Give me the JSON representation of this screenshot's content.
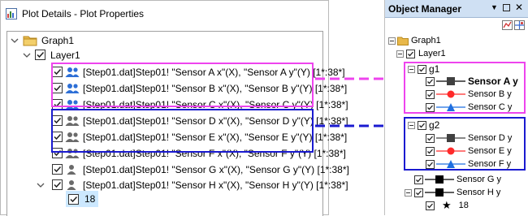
{
  "plot_details": {
    "title": "Plot Details - Plot Properties",
    "tree": {
      "graph": "Graph1",
      "layer": "Layer1",
      "plots": [
        {
          "label": "[Step01.dat]Step01! \"Sensor A x\"(X), \"Sensor A y\"(Y) [1*:38*]",
          "group": "g1"
        },
        {
          "label": "[Step01.dat]Step01! \"Sensor B x\"(X), \"Sensor B y\"(Y) [1*:38*]",
          "group": "g1"
        },
        {
          "label": "[Step01.dat]Step01! \"Sensor C x\"(X), \"Sensor C y\"(Y) [1*:38*]",
          "group": "g1"
        },
        {
          "label": "[Step01.dat]Step01! \"Sensor D x\"(X), \"Sensor D y\"(Y) [1*:38*]",
          "group": "g2"
        },
        {
          "label": "[Step01.dat]Step01! \"Sensor E x\"(X), \"Sensor E y\"(Y) [1*:38*]",
          "group": "g2"
        },
        {
          "label": "[Step01.dat]Step01! \"Sensor F x\"(X), \"Sensor F y\"(Y) [1*:38*]",
          "group": "g2"
        },
        {
          "label": "[Step01.dat]Step01! \"Sensor G x\"(X), \"Sensor G y\"(Y) [1*:38*]",
          "group": ""
        },
        {
          "label": "[Step01.dat]Step01! \"Sensor H x\"(X), \"Sensor H y\"(Y) [1*:38*]",
          "group": ""
        }
      ],
      "sub_item": "18"
    }
  },
  "object_manager": {
    "title": "Object Manager",
    "graph": "Graph1",
    "layer": "Layer1",
    "groups": [
      {
        "name": "g1",
        "items": [
          {
            "label": "Sensor A y",
            "bold": true,
            "marker": "square",
            "color": "#404040"
          },
          {
            "label": "Sensor B y",
            "bold": false,
            "marker": "circle",
            "color": "#ff2a2a"
          },
          {
            "label": "Sensor C y",
            "bold": false,
            "marker": "triangle",
            "color": "#1f6fe0"
          }
        ]
      },
      {
        "name": "g2",
        "items": [
          {
            "label": "Sensor D y",
            "bold": false,
            "marker": "square",
            "color": "#404040"
          },
          {
            "label": "Sensor E y",
            "bold": false,
            "marker": "circle",
            "color": "#ff2a2a"
          },
          {
            "label": "Sensor F y",
            "bold": false,
            "marker": "triangle",
            "color": "#1f6fe0"
          }
        ]
      }
    ],
    "ungrouped": [
      {
        "label": "Sensor G y",
        "marker": "square",
        "color": "#000000"
      },
      {
        "label": "Sensor H y",
        "marker": "square",
        "color": "#000000"
      }
    ],
    "sub_item": "18"
  },
  "colors": {
    "g1_highlight": "#ee44ee",
    "g2_highlight": "#1a1ad0",
    "folder": "#e8b84a",
    "people": "#2d6fd6"
  }
}
